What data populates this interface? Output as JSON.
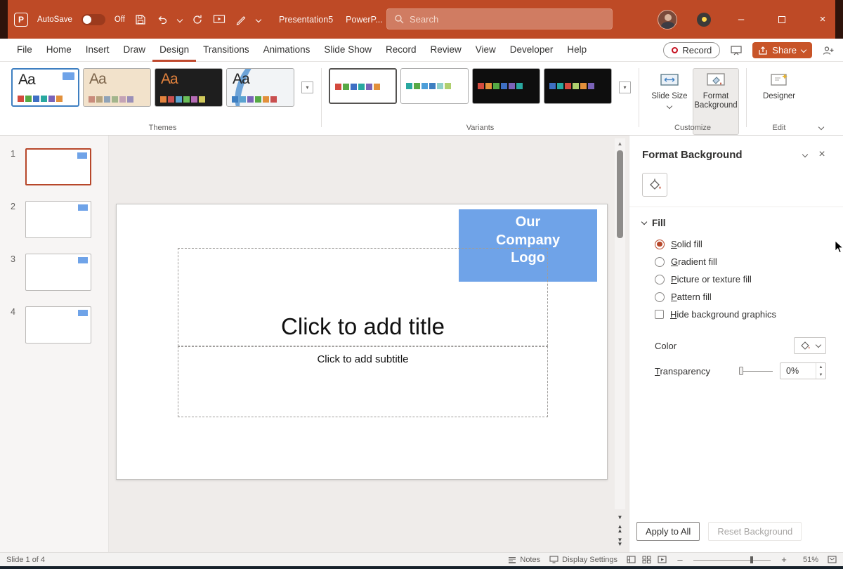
{
  "colors": {
    "titlebar_red": "#BE4A26",
    "accent_red": "#B7472A",
    "active_tab_underline": "#C0492E",
    "share_orange": "#C85428",
    "logo_blue": "#6FA3E8",
    "theme_selection_blue": "#3E7FC1"
  },
  "titlebar": {
    "autosave_label": "AutoSave",
    "autosave_state": "Off",
    "doc_name": "Presentation5",
    "app_name": "PowerP...",
    "search_placeholder": "Search"
  },
  "menu": {
    "tabs": [
      "File",
      "Home",
      "Insert",
      "Draw",
      "Design",
      "Transitions",
      "Animations",
      "Slide Show",
      "Record",
      "Review",
      "View",
      "Developer",
      "Help"
    ],
    "record_label": "Record",
    "share_label": "Share"
  },
  "ribbon": {
    "group_labels": {
      "themes": "Themes",
      "variants": "Variants",
      "customize": "Customize",
      "edit": "Edit"
    },
    "themes": [
      {
        "glyph": "Aa",
        "bg": "#ffffff",
        "text": "#222222",
        "strip": [
          "#D34A3E",
          "#56A944",
          "#3E6FC4",
          "#29A8A0",
          "#7A63B8",
          "#E2903B"
        ]
      },
      {
        "glyph": "Aa",
        "bg": "#F2E2CB",
        "text": "#7A6248",
        "strip": [
          "#C98B7B",
          "#B5A37E",
          "#8FA3B8",
          "#A3B58C",
          "#C4A3B5",
          "#9A8FB8"
        ]
      },
      {
        "glyph": "Aa",
        "bg": "#1E1E1E",
        "text": "#E2823D",
        "strip": [
          "#E2823D",
          "#C94F4F",
          "#5BA3D0",
          "#6BBF59",
          "#B56BB5",
          "#D0C95B"
        ]
      },
      {
        "glyph": "Aa",
        "bg": "#F2F4F6",
        "text": "#222222",
        "strip": [
          "#3E7FC1",
          "#5BA3D0",
          "#7A63B8",
          "#56A944",
          "#E2903B",
          "#C94F4F"
        ]
      }
    ],
    "variants": [
      {
        "bg": "#ffffff",
        "strip": [
          "#D34A3E",
          "#56A944",
          "#3E6FC4",
          "#29A8A0",
          "#7A63B8",
          "#E2903B"
        ]
      },
      {
        "bg": "#ffffff",
        "strip": [
          "#29A8A0",
          "#56A944",
          "#4C9ED9",
          "#3E7FC1",
          "#8FD0C9",
          "#AFCF6E"
        ]
      },
      {
        "bg": "#0E0E0E",
        "strip": [
          "#D34A3E",
          "#E2903B",
          "#56A944",
          "#3E6FC4",
          "#7A63B8",
          "#29A8A0"
        ]
      },
      {
        "bg": "#0E0E0E",
        "strip": [
          "#3E6FC4",
          "#29A8A0",
          "#D34A3E",
          "#AFCF6E",
          "#E2903B",
          "#7A63B8"
        ]
      }
    ],
    "slide_size_label": "Slide Size",
    "format_background_label": "Format Background",
    "designer_label": "Designer"
  },
  "slides_panel": {
    "items": [
      {
        "number": "1",
        "selected": true
      },
      {
        "number": "2",
        "selected": false
      },
      {
        "number": "3",
        "selected": false
      },
      {
        "number": "4",
        "selected": false
      }
    ]
  },
  "slide": {
    "logo_text": "Our Company Logo",
    "title_placeholder": "Click to add title",
    "subtitle_placeholder": "Click to add subtitle"
  },
  "format_pane": {
    "title": "Format Background",
    "section_label": "Fill",
    "options": [
      {
        "label": "Solid fill",
        "selected": true
      },
      {
        "label": "Gradient fill",
        "selected": false
      },
      {
        "label": "Picture or texture fill",
        "selected": false
      },
      {
        "label": "Pattern fill",
        "selected": false
      }
    ],
    "hide_graphics_label": "Hide background graphics",
    "color_label": "Color",
    "transparency_label": "Transparency",
    "transparency_value": "0%",
    "apply_all_label": "Apply to All",
    "reset_label": "Reset Background"
  },
  "statusbar": {
    "slide_info": "Slide 1 of 4",
    "notes_label": "Notes",
    "display_settings_label": "Display Settings",
    "zoom_level": "51%"
  }
}
